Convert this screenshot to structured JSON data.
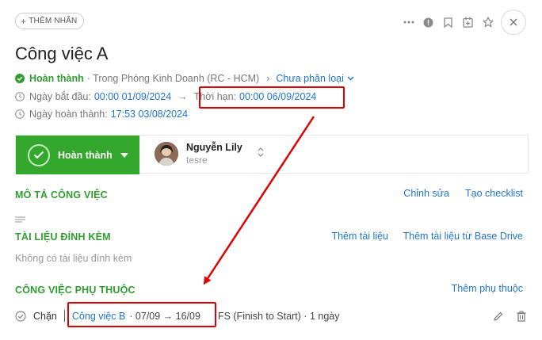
{
  "toolbar": {
    "add_tag_label": "THÊM NHÃN"
  },
  "task": {
    "title": "Công việc A",
    "status_label": "Hoàn thành",
    "location": "· Trong Phòng Kinh Doanh (RC - HCM)",
    "category": "Chưa phân loại",
    "start_label": "Ngày bắt đầu:",
    "start_value": "00:00 01/09/2024",
    "deadline_label": "Thời hạn:",
    "deadline_value": "00:00 06/09/2024",
    "completed_label": "Ngày hoàn thành:",
    "completed_value": "17:53 03/08/2024"
  },
  "status_bar": {
    "button_label": "Hoàn thành",
    "user_name": "Nguyễn Lily",
    "user_sub": "tesre"
  },
  "description": {
    "title": "MÔ TẢ CÔNG VIỆC",
    "edit_link": "Chỉnh sửa",
    "checklist_link": "Tạo checklist"
  },
  "attachments": {
    "title": "TÀI LIỆU ĐÍNH KÈM",
    "add_link": "Thêm tài liệu",
    "add_drive_link": "Thêm tài liệu từ Base Drive",
    "empty_text": "Không có tài liệu đính kèm"
  },
  "dependencies": {
    "title": "CÔNG VIỆC PHỤ THUỘC",
    "add_link": "Thêm phụ thuộc",
    "items": [
      {
        "type": "Chặn",
        "task_name": "Công việc B",
        "dates": "· 07/09 → 16/09",
        "relation": "FS (Finish to Start) · 1 ngày"
      }
    ]
  },
  "colors": {
    "accent_green": "#34a82c",
    "link_blue": "#1f74d1",
    "highlight_red": "#e00000"
  }
}
